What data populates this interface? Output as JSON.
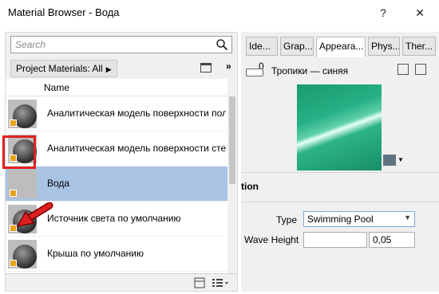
{
  "window": {
    "title": "Material Browser - Вода",
    "help_label": "?",
    "close_label": "✕"
  },
  "left_panel": {
    "search": {
      "placeholder": "Search"
    },
    "filter": {
      "label": "Project Materials: All"
    },
    "expand_label": "»",
    "list": {
      "column_header": "Name",
      "rows": [
        {
          "label": "Аналитическая модель поверхности пола",
          "thumb": "gray-sphere"
        },
        {
          "label": "Аналитическая модель поверхности стены",
          "thumb": "gray-sphere"
        },
        {
          "label": "Вода",
          "thumb": "water",
          "selected": true
        },
        {
          "label": "Источник света по умолчанию",
          "thumb": "gray-sphere"
        },
        {
          "label": "Крыша по умолчанию",
          "thumb": "gray-sphere"
        }
      ]
    }
  },
  "right_panel": {
    "tabs": [
      {
        "label": "Ide..."
      },
      {
        "label": "Grap..."
      },
      {
        "label": "Appeara...",
        "active": true
      },
      {
        "label": "Phys..."
      },
      {
        "label": "Ther..."
      }
    ],
    "asset": {
      "count": "0",
      "name": "Тропики — синяя"
    },
    "section": {
      "title": "tion"
    },
    "properties": {
      "type_label": "Type",
      "type_value": "Swimming Pool",
      "wave_height_label": "Wave Height",
      "wave_height_value": "0,05"
    }
  },
  "colors": {
    "selection": "#a9c3e4",
    "highlight_red": "#e02020",
    "water_green": "#1f9e74"
  }
}
